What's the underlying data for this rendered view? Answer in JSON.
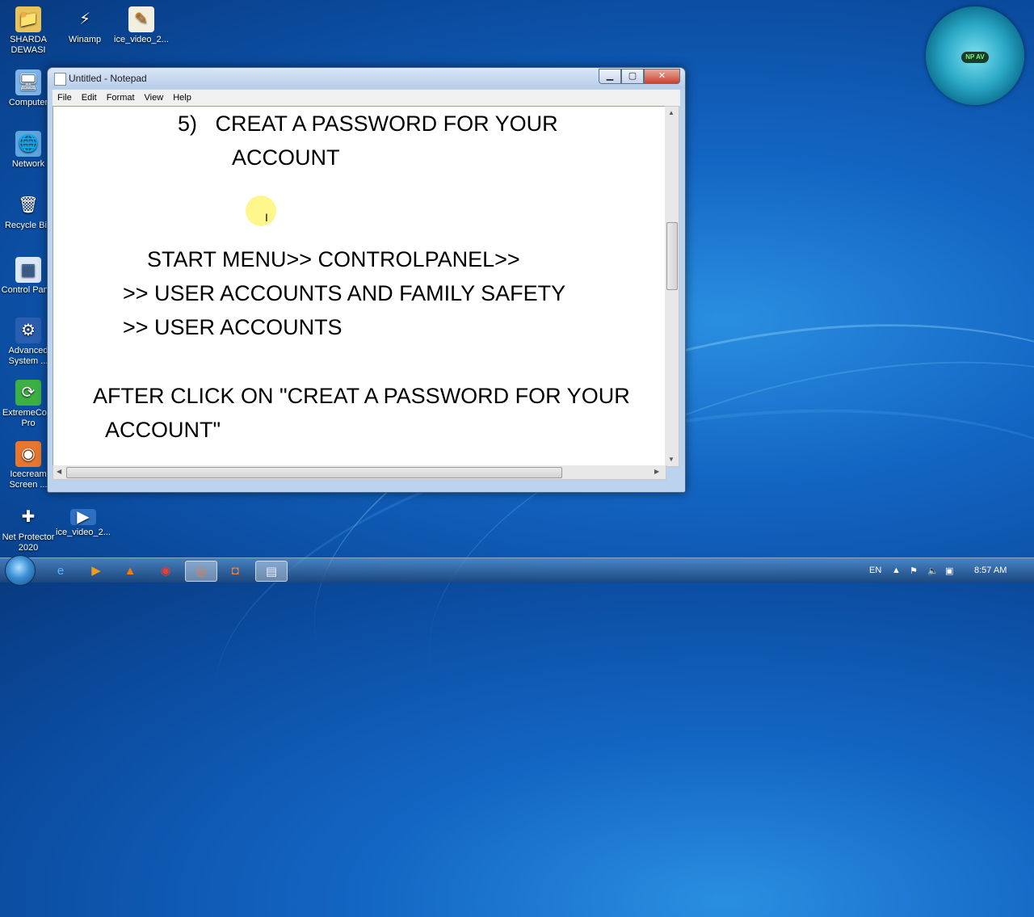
{
  "desktop": {
    "icons": [
      {
        "label": "SHARDA DEWASI",
        "icon": "folder-user-icon"
      },
      {
        "label": "Winamp",
        "icon": "winamp-icon"
      },
      {
        "label": "ice_video_2...",
        "icon": "video-file-icon"
      },
      {
        "label": "Computer",
        "icon": "computer-icon"
      },
      {
        "label": "Network",
        "icon": "network-icon"
      },
      {
        "label": "Recycle Bin",
        "icon": "recycle-bin-icon"
      },
      {
        "label": "Control Panel",
        "icon": "control-panel-icon"
      },
      {
        "label": "Advanced System ...",
        "icon": "advanced-system-icon"
      },
      {
        "label": "ExtremeCo... Pro",
        "icon": "extremecopy-icon"
      },
      {
        "label": "Icecream Screen ...",
        "icon": "icecream-icon"
      },
      {
        "label": "Net Protector 2020",
        "icon": "net-protector-icon"
      },
      {
        "label": "ice_video_2...",
        "icon": "video-file-icon"
      }
    ]
  },
  "notepad": {
    "title": "Untitled - Notepad",
    "menu": [
      "File",
      "Edit",
      "Format",
      "View",
      "Help"
    ],
    "lines": [
      "5)   CREAT A PASSWORD FOR YOUR",
      "ACCOUNT",
      "START MENU>> CONTROLPANEL>>",
      ">> USER ACCOUNTS AND FAMILY SAFETY",
      ">> USER ACCOUNTS",
      "AFTER CLICK ON \"CREAT A PASSWORD FOR YOUR",
      "ACCOUNT\""
    ]
  },
  "gadget": {
    "badge": "NP AV"
  },
  "taskbar": {
    "apps": [
      "ie-icon",
      "media-player-icon",
      "vlc-icon",
      "chrome-icon",
      "icecream-recorder-icon",
      "icecream-screen-icon",
      "notepad-icon"
    ],
    "language": "EN",
    "time": "8:57 AM"
  }
}
